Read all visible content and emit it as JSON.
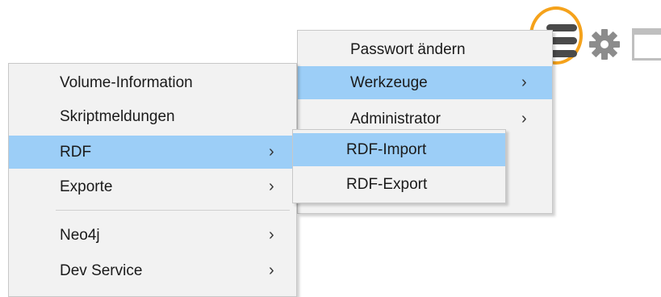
{
  "toolbar": {
    "highlight_color": "#f5a21b",
    "icons": [
      "hamburger-menu-icon",
      "gear-icon",
      "window-icon"
    ]
  },
  "main_menu": {
    "items": [
      {
        "label": "Volume-Information",
        "has_submenu": false
      },
      {
        "label": "Skriptmeldungen",
        "has_submenu": false
      },
      {
        "label": "RDF",
        "has_submenu": true,
        "highlighted": true
      },
      {
        "label": "Exporte",
        "has_submenu": true
      },
      {
        "label": "Neo4j",
        "has_submenu": true
      },
      {
        "label": "Dev Service",
        "has_submenu": true
      }
    ],
    "chevron": "›"
  },
  "top_menu": {
    "items": [
      {
        "label": "Passwort ändern",
        "has_submenu": false
      },
      {
        "label": "Werkzeuge",
        "has_submenu": true,
        "highlighted": true
      },
      {
        "label": "Administrator",
        "has_submenu": true
      }
    ],
    "chevron": "›"
  },
  "rdf_submenu": {
    "items": [
      {
        "label": "RDF-Import",
        "highlighted": true
      },
      {
        "label": "RDF-Export"
      }
    ]
  },
  "colors": {
    "highlight": "#9ccef7",
    "menu_background": "#f2f2f2"
  }
}
